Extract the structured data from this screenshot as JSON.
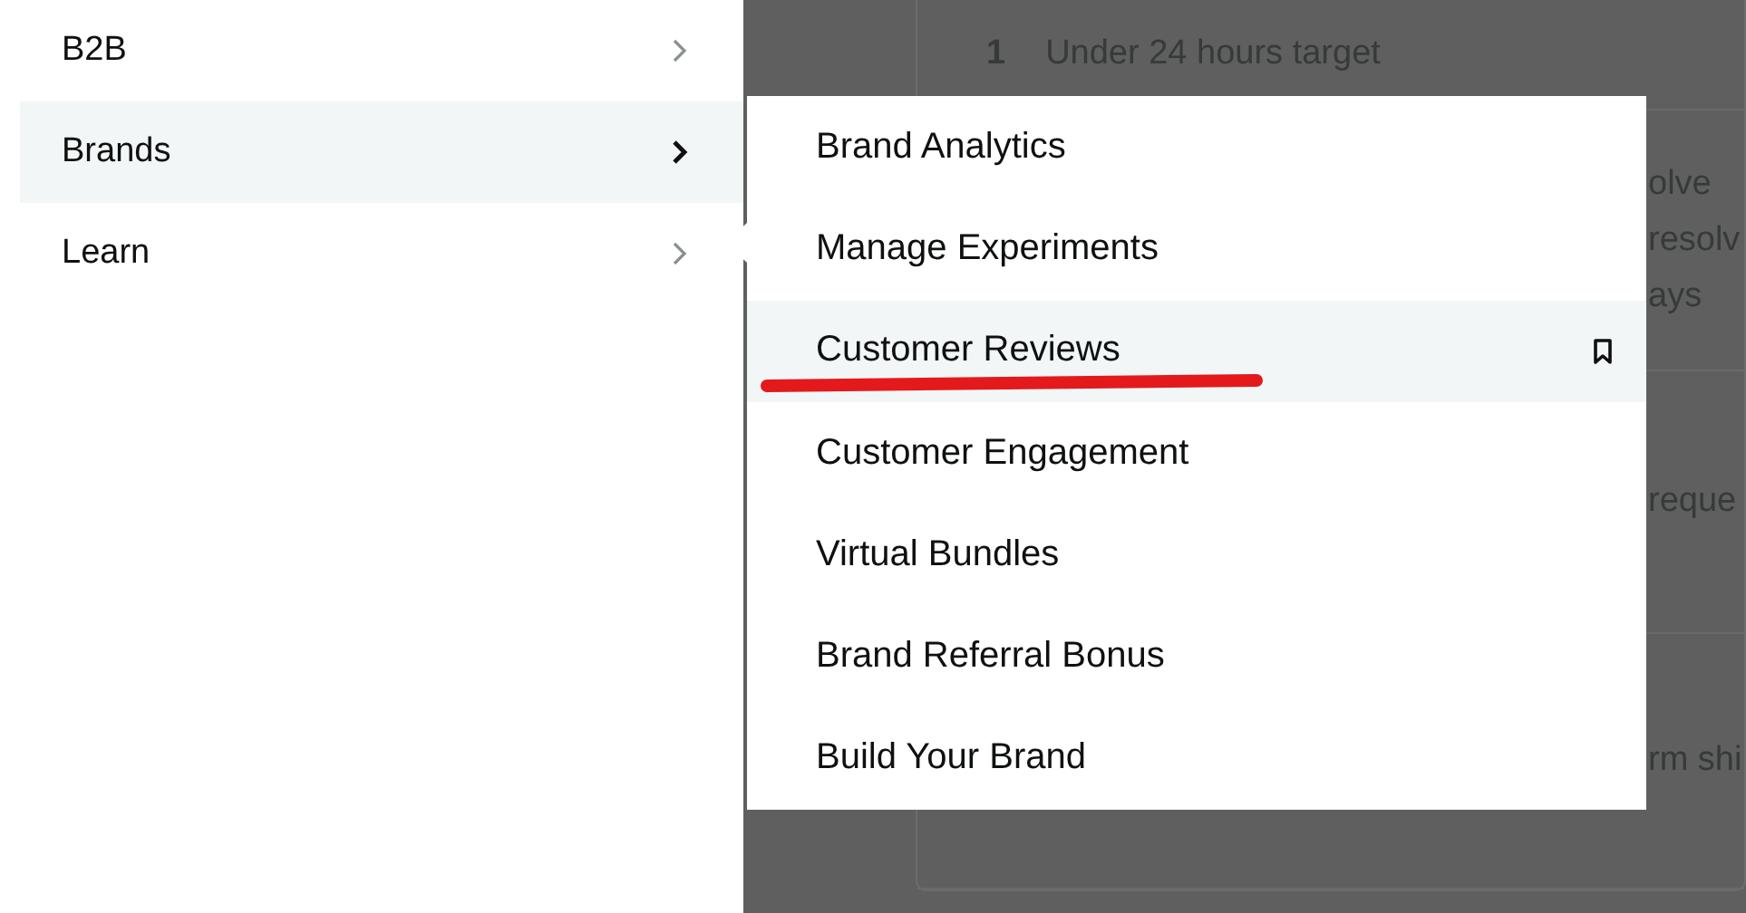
{
  "nav": {
    "items": [
      {
        "label": "B2B",
        "selected": false
      },
      {
        "label": "Brands",
        "selected": true
      },
      {
        "label": "Learn",
        "selected": false
      }
    ]
  },
  "background_card": {
    "target_number": "1",
    "target_text": "Under 24 hours target",
    "sections": [
      {
        "lines": [
          "olve",
          "resolv",
          "ays"
        ]
      },
      {
        "lines": [
          "reque"
        ]
      },
      {
        "lines": [
          "rm shi"
        ]
      }
    ]
  },
  "submenu": {
    "items": [
      {
        "label": "Brand Analytics",
        "selected": false,
        "annotated": false
      },
      {
        "label": "Manage Experiments",
        "selected": false,
        "annotated": false
      },
      {
        "label": "Customer Reviews",
        "selected": true,
        "annotated": true
      },
      {
        "label": "Customer Engagement",
        "selected": false,
        "annotated": false
      },
      {
        "label": "Virtual Bundles",
        "selected": false,
        "annotated": false
      },
      {
        "label": "Brand Referral Bonus",
        "selected": false,
        "annotated": false
      },
      {
        "label": "Build Your Brand",
        "selected": false,
        "annotated": false
      }
    ]
  }
}
